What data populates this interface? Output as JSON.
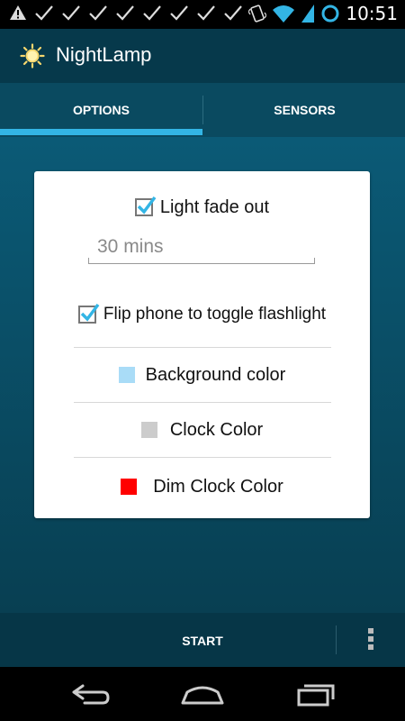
{
  "status_bar": {
    "time": "10:51",
    "icons": [
      "warning-icon",
      "check-icon",
      "check-icon",
      "check-icon",
      "check-icon",
      "check-icon",
      "check-icon",
      "check-icon",
      "check-icon",
      "vibrate-icon",
      "wifi-icon",
      "signal-icon",
      "sync-ring-icon"
    ]
  },
  "app": {
    "title": "NightLamp",
    "icon": "sun-icon"
  },
  "tabs": [
    {
      "label": "OPTIONS",
      "selected": true
    },
    {
      "label": "SENSORS",
      "selected": false
    }
  ],
  "options": {
    "light_fade_out": {
      "label": "Light fade out",
      "checked": true
    },
    "fade_duration": {
      "value": "30 mins"
    },
    "flip_flashlight": {
      "label": "Flip phone to toggle flashlight",
      "checked": true
    },
    "background_color": {
      "label": "Background color",
      "color": "#a9dcf7"
    },
    "clock_color": {
      "label": "Clock Color",
      "color": "#cccccc"
    },
    "dim_clock_color": {
      "label": "Dim Clock Color",
      "color": "#ff0000"
    }
  },
  "bottom_bar": {
    "start_label": "START",
    "overflow_icon": "overflow-menu-icon"
  },
  "nav_bar": {
    "buttons": [
      "back-icon",
      "home-icon",
      "recents-icon"
    ]
  },
  "colors": {
    "accent": "#33b5e5",
    "actionbar": "#06394b",
    "background": "#0b5a76"
  }
}
